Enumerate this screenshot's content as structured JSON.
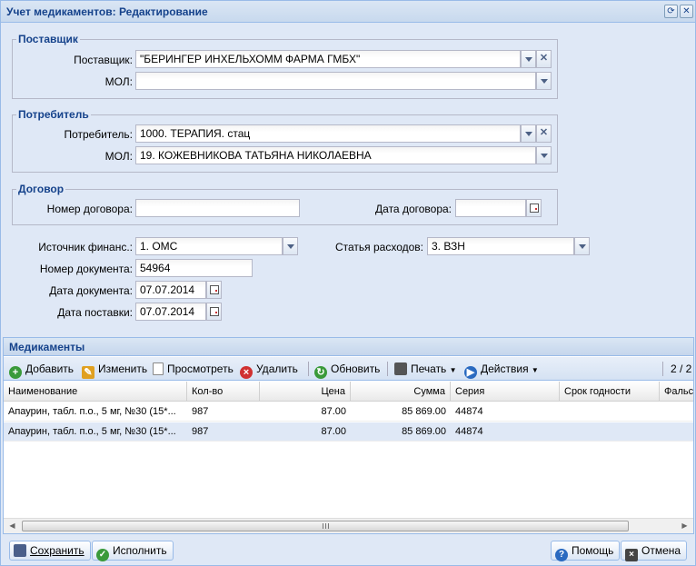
{
  "window": {
    "title": "Учет медикаментов: Редактирование"
  },
  "supplier_section": {
    "legend": "Поставщик",
    "supplier_label": "Поставщик:",
    "supplier_value": "\"БЕРИНГЕР ИНХЕЛЬХОММ ФАРМА ГМБХ\"",
    "mol_label": "МОЛ:",
    "mol_value": ""
  },
  "consumer_section": {
    "legend": "Потребитель",
    "consumer_label": "Потребитель:",
    "consumer_value": "1000. ТЕРАПИЯ. стац",
    "mol_label": "МОЛ:",
    "mol_value": "19. КОЖЕВНИКОВА ТАТЬЯНА НИКОЛАЕВНА"
  },
  "contract_section": {
    "legend": "Договор",
    "number_label": "Номер договора:",
    "number_value": "",
    "date_label": "Дата договора:",
    "date_value": ""
  },
  "fields": {
    "finance_source_label": "Источник финанс.:",
    "finance_source_value": "1. ОМС",
    "expense_item_label": "Статья расходов:",
    "expense_item_value": "3. ВЗН",
    "doc_number_label": "Номер документа:",
    "doc_number_value": "54964",
    "doc_date_label": "Дата документа:",
    "doc_date_value": "07.07.2014",
    "delivery_date_label": "Дата поставки:",
    "delivery_date_value": "07.07.2014"
  },
  "medications": {
    "title": "Медикаменты",
    "toolbar": {
      "add": "Добавить",
      "edit": "Изменить",
      "view": "Просмотреть",
      "delete": "Удалить",
      "refresh": "Обновить",
      "print": "Печать",
      "actions": "Действия",
      "page_info": "2 / 2"
    },
    "columns": [
      "Наименование",
      "Кол-во",
      "Цена",
      "Сумма",
      "Серия",
      "Срок годности",
      "Фальс"
    ],
    "rows": [
      [
        "Апаурин, табл. п.о., 5 мг, №30 (15*...",
        "987",
        "87.00",
        "85 869.00",
        "44874",
        ""
      ],
      [
        "Апаурин, табл. п.о., 5 мг, №30 (15*...",
        "987",
        "87.00",
        "85 869.00",
        "44874",
        ""
      ]
    ]
  },
  "footer": {
    "save": "Сохранить",
    "execute": "Исполнить",
    "help": "Помощь",
    "cancel": "Отмена"
  }
}
